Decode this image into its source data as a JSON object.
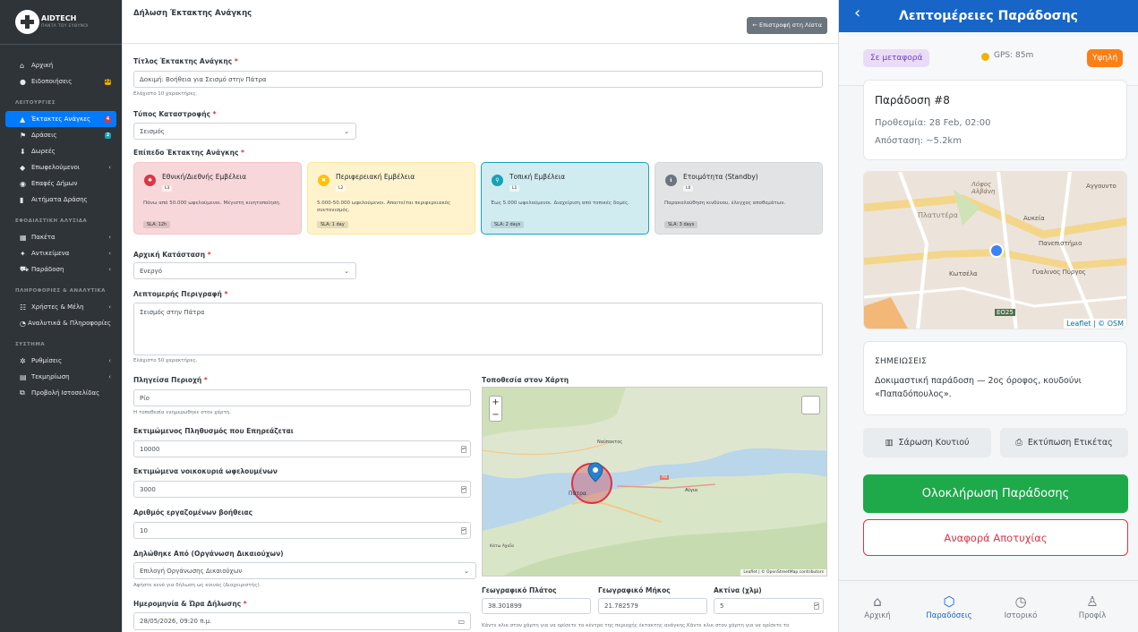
{
  "brand": {
    "name": "AIDTECH",
    "sub": "ΠΑΝΤΑ ΤΟΥ ΕΥΘΥΝΟΙ"
  },
  "sidebar": {
    "top": [
      {
        "label": "Αρχική",
        "icon": "home-icon"
      },
      {
        "label": "Ειδοποιήσεις",
        "icon": "bell-icon",
        "badge": "22"
      }
    ],
    "sections": [
      {
        "head": "ΛΕΙΤΟΥΡΓΙΕΣ",
        "items": [
          {
            "label": "Έκτακτες Ανάγκες",
            "badge": "4",
            "active": true
          },
          {
            "label": "Δράσεις",
            "badge": "2"
          },
          {
            "label": "Δωρεές"
          },
          {
            "label": "Επωφελούμενοι",
            "chev": true
          },
          {
            "label": "Επαφές Δήμων"
          },
          {
            "label": "Αιτήματα Δράσης"
          }
        ]
      },
      {
        "head": "ΕΦΟΔΙΑΣΤΙΚΗ ΑΛΥΣΙΔΑ",
        "items": [
          {
            "label": "Πακέτα",
            "chev": true
          },
          {
            "label": "Αντικείμενα",
            "chev": true
          },
          {
            "label": "Παράδοση",
            "chev": true
          }
        ]
      },
      {
        "head": "ΠΛΗΡΟΦΟΡΙΕΣ & ΑΝΑΛΥΤΙΚΑ",
        "items": [
          {
            "label": "Χρήστες & Μέλη",
            "chev": true
          },
          {
            "label": "Αναλυτικά & Πληροφορίες"
          }
        ]
      },
      {
        "head": "ΣΥΣΤΗΜΑ",
        "items": [
          {
            "label": "Ρυθμίσεις",
            "chev": true
          },
          {
            "label": "Τεκμηρίωση",
            "chev": true
          },
          {
            "label": "Προβολή Ιστοσελίδας"
          }
        ]
      }
    ]
  },
  "form": {
    "title": "Δήλωση Έκτακτης Ανάγκης",
    "back": "← Επιστροφή στη Λίστα",
    "f_title_label": "Τίτλος Έκτακτης Ανάγκης",
    "f_title_value": "Δοκιμή: Βοήθεια για Σεισμό στην Πάτρα",
    "f_title_hint": "Ελάχιστο 10 χαρακτήρες.",
    "f_type_label": "Τύπος Καταστροφής",
    "f_type_value": "Σεισμός",
    "f_level_label": "Επίπεδο Έκτακτης Ανάγκης",
    "levels": [
      {
        "title": "Εθνική/Διεθνής Εμβέλεια",
        "code": "L3",
        "desc": "Πάνω από 50.000 ωφελούμενοι. Μέγιστη κινητοποίηση.",
        "sla": "SLA: 12h",
        "bg": "#f8d7da",
        "border": "#f5c2c7",
        "icon_bg": "#dc3545"
      },
      {
        "title": "Περιφερειακή Εμβέλεια",
        "code": "L2",
        "desc": "5.000-50.000 ωφελούμενοι. Απαιτείται περιφερειακός συντονισμός.",
        "sla": "SLA: 1 day",
        "bg": "#fff3cd",
        "border": "#ffe69c",
        "icon_bg": "#ffc107"
      },
      {
        "title": "Τοπική Εμβέλεια",
        "code": "L1",
        "desc": "Έως 5.000 ωφελούμενοι. Διαχείριση από τοπικές δομές.",
        "sla": "SLA: 2 days",
        "bg": "#d1ecf1",
        "border": "#17a2b8",
        "icon_bg": "#17a2b8"
      },
      {
        "title": "Ετοιμότητα (Standby)",
        "code": "L0",
        "desc": "Παρακολούθηση κινδύνου, έλεγχος αποθεμάτων.",
        "sla": "SLA: 3 days",
        "bg": "#e2e3e5",
        "border": "#d3d6d8",
        "icon_bg": "#6c757d"
      }
    ],
    "f_status_label": "Αρχική Κατάσταση",
    "f_status_value": "Ενεργό",
    "f_desc_label": "Λεπτομερής Περιγραφή",
    "f_desc_value": "Σεισμός στην Πάτρα",
    "f_desc_hint": "Ελάχιστο 50 χαρακτήρες.",
    "f_area_label": "Πληγείσα Περιοχή",
    "f_area_value": "Ρίο",
    "f_area_hint": "Η τοποθεσία ενημερώθηκε στον χάρτη.",
    "f_pop_label": "Εκτιμώμενος Πληθυσμός που Επηρεάζεται",
    "f_pop_value": "10000",
    "f_house_label": "Εκτιμώμενα νοικοκυριά ωφελουμένων",
    "f_house_value": "3000",
    "f_workers_label": "Αριθμός εργαζομένων βοήθειας",
    "f_workers_value": "10",
    "f_org_label": "Δηλώθηκε Από (Οργάνωση Δικαιούχων)",
    "f_org_value": "Επιλογή Οργάνωσης Δικαιούχων",
    "f_org_hint": "Αφήστε κενό για δήλωση ως κοινός (Διαχειριστής).",
    "f_date_label": "Ημερομηνία & Ώρα Δήλωσης",
    "f_date_value": "28/05/2026, 09:20 π.μ.",
    "map_label": "Τοποθεσία στον Χάρτη",
    "map_places": [
      "Ναύπακτος",
      "Πάτρα",
      "Αίγιο",
      "Κάτω Αχαΐα",
      "A8"
    ],
    "map_attrib": "Leaflet | © OpenStreetMap contributors",
    "lat_label": "Γεωγραφικό Πλάτος",
    "lat_value": "38.301899",
    "lng_label": "Γεωγραφικό Μήκος",
    "lng_value": "21.782579",
    "rad_label": "Ακτίνα (χλμ)",
    "rad_value": "5",
    "map_hint": "Κάντε κλικ στον χάρτη για να ορίσετε το κέντρο της περιοχής έκτακτης ανάγκης.Κάντε κλικ στον χάρτη για να ορίσετε το"
  },
  "mobile": {
    "title": "Λεπτομέρειες Παράδοσης",
    "status": "Σε μεταφορά",
    "gps": "GPS: 85m",
    "priority": "Υψηλή",
    "delivery_title": "Παράδοση #8",
    "deadline": "Προθεσμία: 28 Feb, 02:00",
    "distance": "Απόσταση: ~5.2km",
    "map_places": [
      "Λόφος Αλβάνη",
      "Πλατυτέρα",
      "Αυκεία",
      "Πανεπιστήμιο",
      "Κωτσέλα",
      "Γυαλινος Πύργος",
      "Αγγουντο",
      "EO25"
    ],
    "map_attrib": "Leaflet | © OSM",
    "notes_head": "ΣΗΜΕΙΩΣΕΙΣ",
    "notes": "Δοκιμαστική παράδοση — 2ος όροφος, κουδούνι «Παπαδόπουλος».",
    "scan": "Σάρωση Κουτιού",
    "print": "Εκτύπωση Ετικέτας",
    "complete": "Ολοκλήρωση Παράδοσης",
    "fail": "Αναφορά Αποτυχίας",
    "nav": [
      {
        "label": "Αρχική",
        "icon": "home-icon"
      },
      {
        "label": "Παραδόσεις",
        "icon": "box-icon",
        "active": true
      },
      {
        "label": "Ιστορικό",
        "icon": "clock-icon"
      },
      {
        "label": "Προφίλ",
        "icon": "user-icon"
      }
    ],
    "colors": {
      "primary": "#1766c7",
      "success": "#1ea94b",
      "danger": "#dc3545",
      "orange": "#fd7e14"
    }
  }
}
